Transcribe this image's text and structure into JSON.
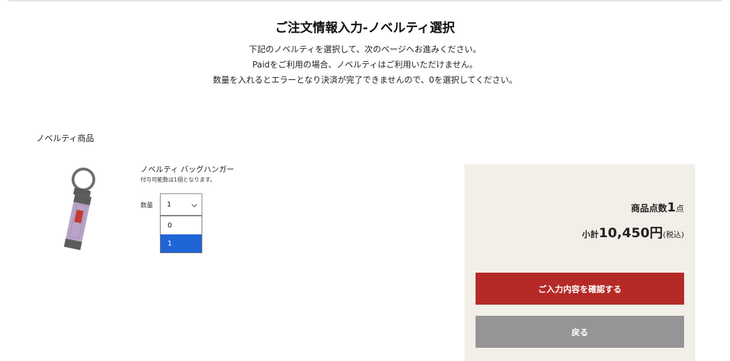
{
  "header": {
    "title": "ご注文情報入力-ノベルティ選択",
    "lines": [
      "下記のノベルティを選択して、次のページへお進みください。",
      "Paidをご利用の場合、ノベルティはご利用いただけません。",
      "数量を入れるとエラーとなり決済が完了できませんので、0を選択してください。"
    ]
  },
  "section": {
    "label": "ノベルティ商品"
  },
  "product": {
    "name": "ノベルティ バッグハンガー",
    "note": "付与可能数は1個となります。",
    "image_icon": "keychain-bag-hanger",
    "quantity_label": "数量",
    "quantity_value": "1",
    "quantity_options": [
      "0",
      "1"
    ],
    "quantity_highlighted": "1"
  },
  "summary": {
    "count_label": "商品点数",
    "count_value": "1",
    "count_unit": "点",
    "subtotal_label": "小計",
    "subtotal_value": "10,450円",
    "subtotal_tax": "(税込)",
    "confirm_label": "ご入力内容を確認する",
    "back_label": "戻る"
  },
  "colors": {
    "confirm": "#b52a27",
    "back": "#959595",
    "panel": "#f2efe8",
    "highlight": "#1f65d6",
    "strap": "#b9a4c9"
  }
}
